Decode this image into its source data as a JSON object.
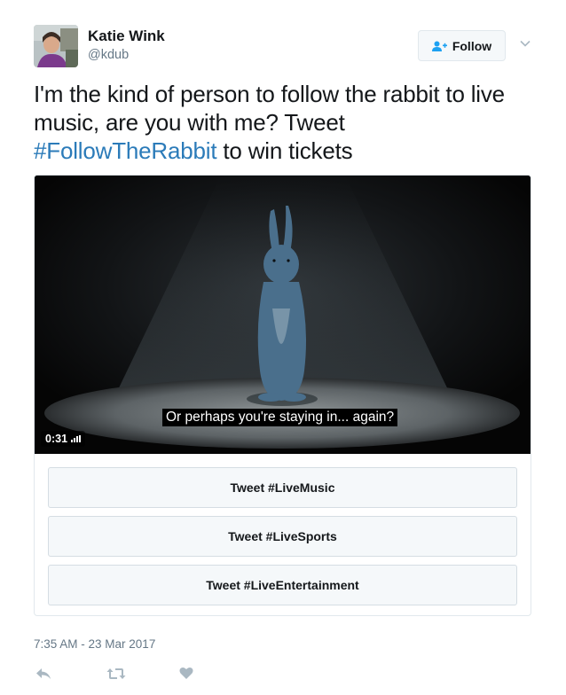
{
  "user": {
    "name": "Katie Wink",
    "handle": "@kdub"
  },
  "follow_label": "Follow",
  "tweet": {
    "text_part1": "I'm the kind of person to follow the rabbit to live music, are you with me? Tweet ",
    "hashtag": "#FollowTheRabbit",
    "text_part2": " to win tickets"
  },
  "video": {
    "caption": "Or perhaps you're staying in... again?",
    "duration": "0:31"
  },
  "poll_options": [
    "Tweet #LiveMusic",
    "Tweet #LiveSports",
    "Tweet #LiveEntertainment"
  ],
  "timestamp": "7:35 AM - 23 Mar 2017",
  "icons": {
    "follow": "add-user-icon",
    "caret": "chevron-down-icon",
    "reply": "reply-icon",
    "retweet": "retweet-icon",
    "like": "heart-icon"
  },
  "colors": {
    "hashtag": "#2b7bb9",
    "muted": "#657786",
    "icon_gray": "#aab8c2"
  }
}
